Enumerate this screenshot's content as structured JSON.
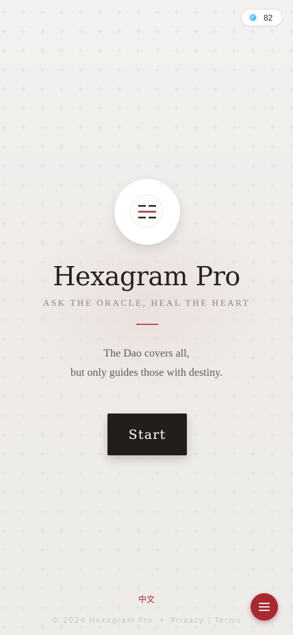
{
  "credits": {
    "count": "82",
    "icon": "gem-icon"
  },
  "logo": {
    "icon": "hexagram-icon",
    "line_colors": [
      "#2b2b2b",
      "#b0373e",
      "#2b2b2b"
    ]
  },
  "hero": {
    "title": "Hexagram Pro",
    "tagline": "ASK THE ORACLE, HEAL THE HEART",
    "motto_line1": "The Dao covers all,",
    "motto_line2": "but only guides those with destiny."
  },
  "start_button": {
    "label": "Start"
  },
  "language": {
    "label": "中文"
  },
  "footer": {
    "copyright": "© 2024 Hexagram Pro",
    "separator": "•",
    "privacy": "Privacy",
    "pipe": "|",
    "terms": "Terms"
  },
  "menu_button": {
    "icon": "menu-icon"
  },
  "colors": {
    "accent": "#a82a30",
    "button": "#221e1c",
    "title": "#27221f"
  }
}
